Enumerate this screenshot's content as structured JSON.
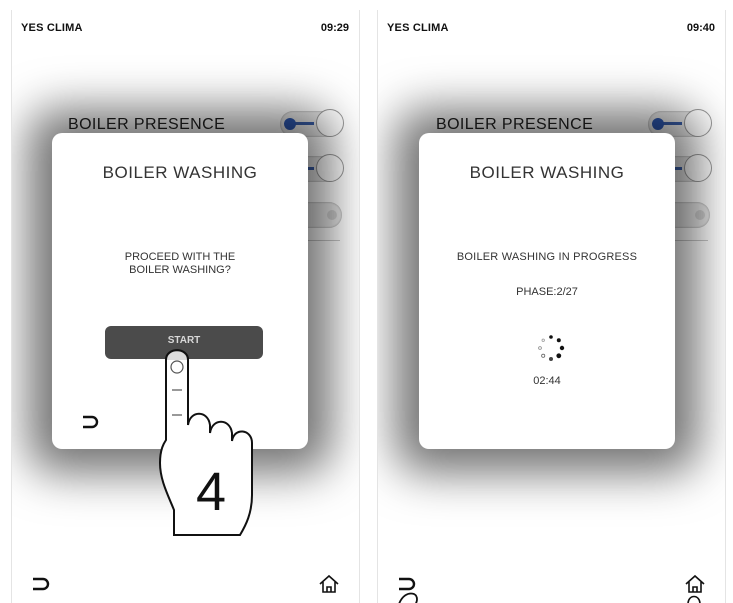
{
  "left_screen": {
    "brand": "YES CLIMA",
    "clock": "09:29",
    "background_label": "BOILER PRESENCE",
    "modal": {
      "title": "BOILER WASHING",
      "question": "PROCEED WITH THE\nBOILER WASHING?",
      "start_label": "START"
    },
    "step_number": "4"
  },
  "right_screen": {
    "brand": "YES CLIMA",
    "clock": "09:40",
    "background_label": "BOILER PRESENCE",
    "modal": {
      "title": "BOILER WASHING",
      "status": "BOILER WASHING IN PROGRESS",
      "phase": "PHASE:2/27",
      "timer": "02:44"
    }
  },
  "icons": {
    "back": "back-arrow-icon",
    "home": "home-icon",
    "spinner": "loading-spinner-icon",
    "pointer": "pointing-hand-icon"
  },
  "colors": {
    "toggle_on": "#2e58b0",
    "button_dark": "#4b4b4b",
    "overlay": "#000000"
  }
}
